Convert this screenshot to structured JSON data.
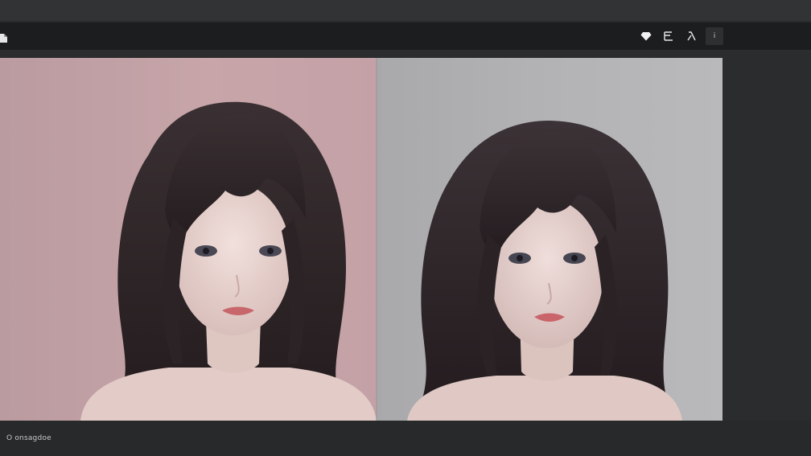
{
  "toolbar": {
    "logo_icon": "document-icon",
    "tools": [
      {
        "name": "diamond-icon"
      },
      {
        "name": "layers-icon"
      },
      {
        "name": "lambda-icon"
      },
      {
        "name": "info-icon",
        "label": "i"
      }
    ]
  },
  "canvas": {
    "left_background": "#c5a3a8",
    "right_background": "#b2b2b4",
    "hair_color": "#2a2224",
    "skin_color": "#ead6d2"
  },
  "statusbar": {
    "text": "O onsagdoe"
  }
}
